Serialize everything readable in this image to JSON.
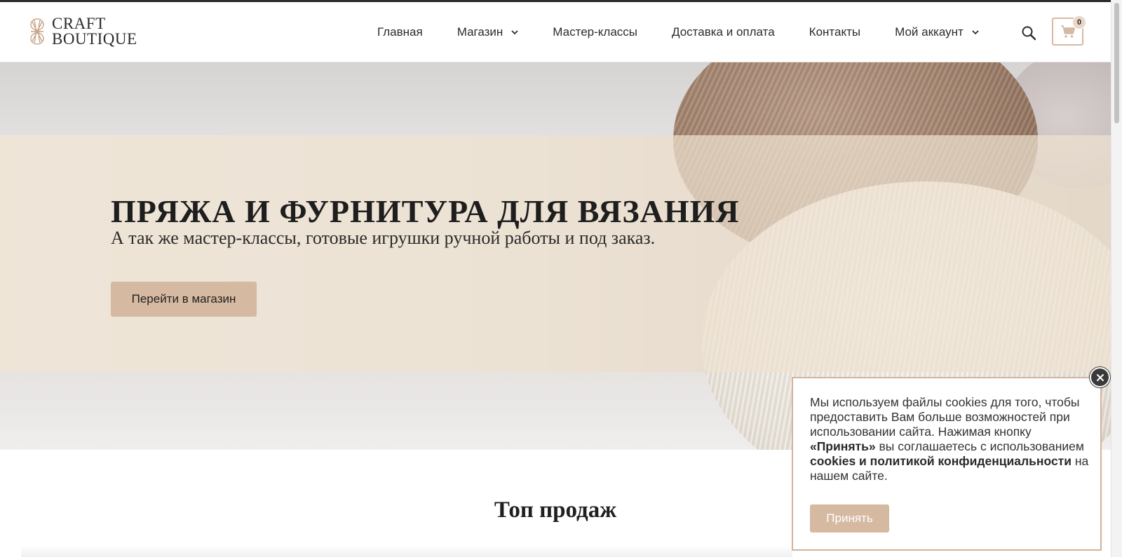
{
  "header": {
    "logo_line1": "CRAFT",
    "logo_line2": "BOUTIQUE",
    "nav": [
      {
        "label": "Главная"
      },
      {
        "label": "Магазин"
      },
      {
        "label": "Мастер-классы"
      },
      {
        "label": "Доставка и оплата"
      },
      {
        "label": "Контакты"
      },
      {
        "label": "Мой аккаунт"
      }
    ],
    "search_icon": "search-icon",
    "cart_icon": "cart-icon",
    "cart_count": "0"
  },
  "hero": {
    "title": "ПРЯЖА И ФУРНИТУРА ДЛЯ ВЯЗАНИЯ",
    "subtitle": "А так же мастер-классы, готовые игрушки ручной работы и под заказ.",
    "button_label": "Перейти в магазин"
  },
  "section": {
    "title": "Топ продаж"
  },
  "cookie": {
    "text_1": "Мы используем файлы cookies для того, чтобы предоставить Вам больше возможностей при использовании сайта. Нажимая кнопку ",
    "text_bold_1": "«Принять»",
    "text_2": " вы соглашаетесь с использованием ",
    "text_bold_2": "cookies и политикой конфиденциальности",
    "text_3": " на нашем сайте.",
    "accept_label": "Принять",
    "close_icon": "close-icon"
  },
  "colors": {
    "accent": "#d6b9a1",
    "band": "#efe2d0",
    "text": "#2b2b2b"
  }
}
